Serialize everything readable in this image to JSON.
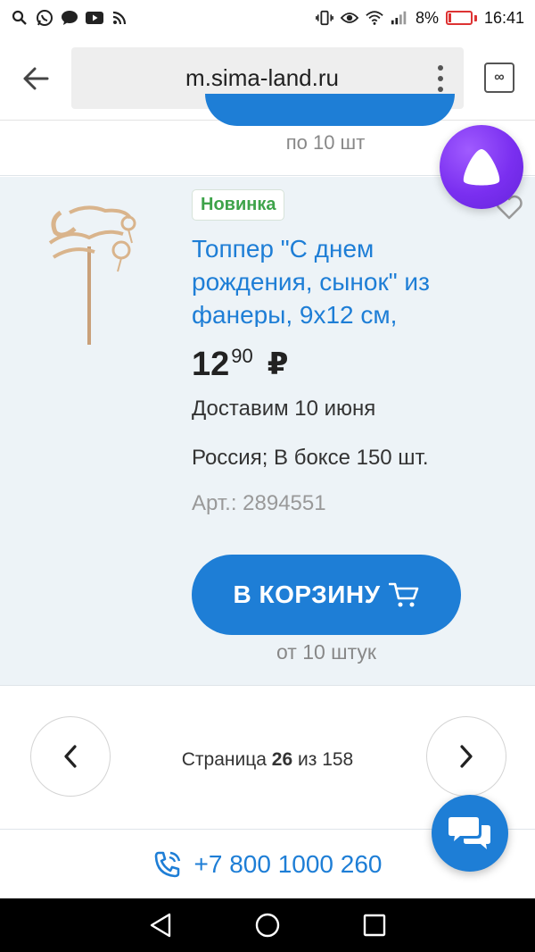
{
  "status_bar": {
    "battery_percent": "8%",
    "time": "16:41",
    "left_icons": [
      "search-icon",
      "whatsapp-icon",
      "message-icon",
      "youtube-icon",
      "rss-icon"
    ],
    "right_icons": [
      "vibrate-icon",
      "eye-icon",
      "wifi-icon",
      "signal-icon",
      "battery-icon"
    ]
  },
  "browser": {
    "url": "m.sima-land.ru",
    "tabs_label": "∞"
  },
  "previous_product": {
    "min_quantity": "по 10 шт"
  },
  "product": {
    "badge": "Новинка",
    "title": "Топпер \"С днем рождения, сынок\" из фанеры, 9х12 см,",
    "price_integer": "12",
    "price_decimal": "90",
    "currency": "₽",
    "delivery": "Доставим 10 июня",
    "origin": "Россия; В боксе 150 шт.",
    "article": "Арт.: 2894551",
    "cart_button": "В КОРЗИНУ",
    "min_quantity": "от 10 штук"
  },
  "pagination": {
    "label": "Страница",
    "current": "26",
    "of": "из",
    "total": "158"
  },
  "footer": {
    "phone": "+7 800 1000 260"
  },
  "colors": {
    "accent": "#1e7ed6",
    "new_badge": "#3ea34a",
    "card_bg": "#edf3f7",
    "assistant": "#7a2ff0"
  }
}
